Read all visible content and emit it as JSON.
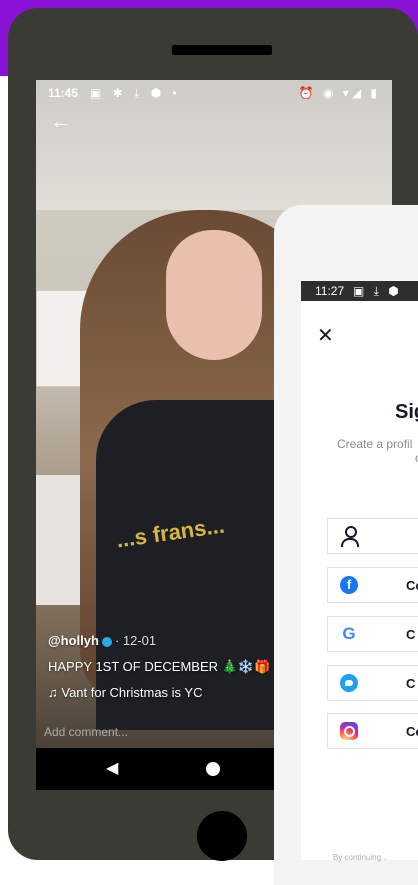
{
  "back_phone": {
    "status_bar": {
      "time": "11:45",
      "left_icons": "▣ ✱ ⤓ ⬢ •",
      "right_icons": "⏰ ◉ ▾◢ ▮"
    },
    "video": {
      "shirt_text": "...s frans..."
    },
    "caption": {
      "username": "@hollyh",
      "date": "· 12-01",
      "text": "HAPPY 1ST OF DECEMBER 🎄❄️🎁",
      "music_icon": "♫",
      "music": "Vant for Christmas is YC"
    },
    "comment_placeholder": "Add comment...",
    "nav": {
      "back": "◀",
      "home": ""
    }
  },
  "front_phone": {
    "status_bar": {
      "time": "11:27",
      "icons": "▣ ⤓ ⬢ ◎"
    },
    "close": "✕",
    "title": "Sig",
    "subtitle_line1": "Create a profil",
    "subtitle_line2": "c",
    "options": [
      {
        "icon": "person-icon",
        "label": ""
      },
      {
        "icon": "facebook-icon",
        "label": "Co"
      },
      {
        "icon": "google-icon",
        "label": "C"
      },
      {
        "icon": "twitter-icon",
        "label": "C"
      },
      {
        "icon": "instagram-icon",
        "label": "Co"
      }
    ],
    "footer": "By continuing..."
  },
  "colors": {
    "brand_purple": "#8a12d6",
    "phone_body": "#3a3b35",
    "facebook": "#1877f2",
    "twitter": "#1da1f2"
  }
}
